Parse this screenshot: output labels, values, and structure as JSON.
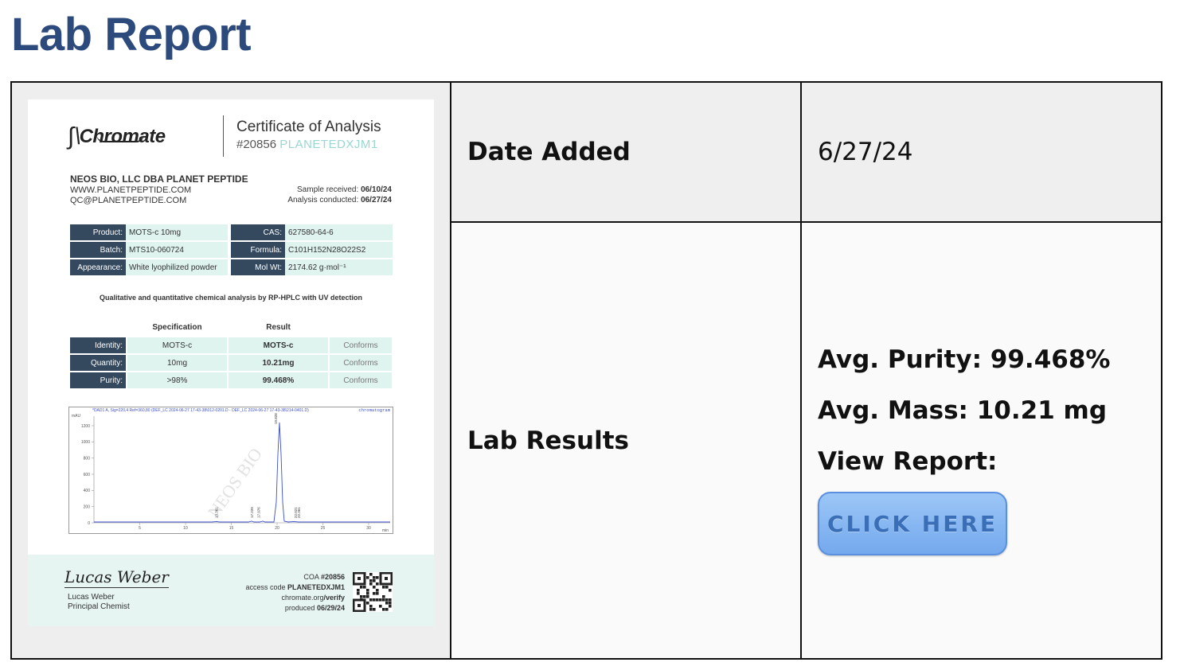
{
  "page": {
    "title": "Lab Report"
  },
  "table": {
    "date_label": "Date Added",
    "date_value": "6/27/24",
    "results_label": "Lab Results",
    "avg_purity": "Avg. Purity: 99.468%",
    "avg_mass": "Avg. Mass: 10.21 mg",
    "view_report": "View Report:",
    "button_label": "CLICK HERE"
  },
  "coa": {
    "logo_text": "Chromate",
    "title": "Certificate of Analysis",
    "number": "#20856",
    "code": "PLANETEDXJM1",
    "client_name": "NEOS BIO, LLC DBA PLANET PEPTIDE",
    "client_web": "WWW.PLANETPEPTIDE.COM",
    "client_email": "QC@PLANETPEPTIDE.COM",
    "sample_received_label": "Sample received:",
    "sample_received": "06/10/24",
    "analysis_conducted_label": "Analysis conducted:",
    "analysis_conducted": "06/27/24",
    "info": {
      "product_label": "Product:",
      "product": "MOTS-c 10mg",
      "cas_label": "CAS:",
      "cas": "627580-64-6",
      "batch_label": "Batch:",
      "batch": "MTS10-060724",
      "formula_label": "Formula:",
      "formula": "C101H152N28O22S2",
      "appearance_label": "Appearance:",
      "appearance": "White lyophilized powder",
      "molwt_label": "Mol Wt:",
      "molwt": "2174.62 g·mol⁻¹"
    },
    "method": "Qualitative and quantitative chemical analysis by RP-HPLC with UV detection",
    "spec_header": "Specification",
    "result_header": "Result",
    "spec_rows": [
      {
        "label": "Identity:",
        "spec": "MOTS-c",
        "result": "MOTS-c",
        "status": "Conforms"
      },
      {
        "label": "Quantity:",
        "spec": "10mg",
        "result": "10.21mg",
        "status": "Conforms"
      },
      {
        "label": "Purity:",
        "spec": ">98%",
        "result": "99.468%",
        "status": "Conforms"
      }
    ],
    "chromatogram": {
      "header": "*DAD1 A, Sig=220,4 Ref=360,80 (DEF_LC 2024-06-27 17-43-38\\012-0201.D - DEF_LC 2024-06-27 17-43-38\\214-0401.D)",
      "tag": "chromatogram",
      "y_unit": "mAU",
      "x_unit": "min",
      "y_ticks": [
        "1200",
        "1000",
        "800",
        "600",
        "400",
        "200",
        "0"
      ],
      "x_ticks": [
        "5",
        "10",
        "15",
        "20",
        "25",
        "30"
      ],
      "peak_labels": [
        "13.361",
        "17.220",
        "17.976",
        "19.828",
        "22.021",
        "22.361"
      ],
      "watermark": "NEOS BIO"
    },
    "signature": "Lucas Weber",
    "signer_name": "Lucas Weber",
    "signer_title": "Principal Chemist",
    "verify": {
      "coa_label": "COA",
      "coa_number": "#20856",
      "access_label": "access code",
      "access_code": "PLANETEDXJM1",
      "site_prefix": "chromate.org",
      "site_suffix": "/verify",
      "produced_label": "produced",
      "produced": "06/29/24"
    }
  },
  "colors": {
    "title": "#2c4a7c",
    "label_dark": "#34495e",
    "cell_teal": "#dff3ef",
    "button": "#74a9ee"
  }
}
